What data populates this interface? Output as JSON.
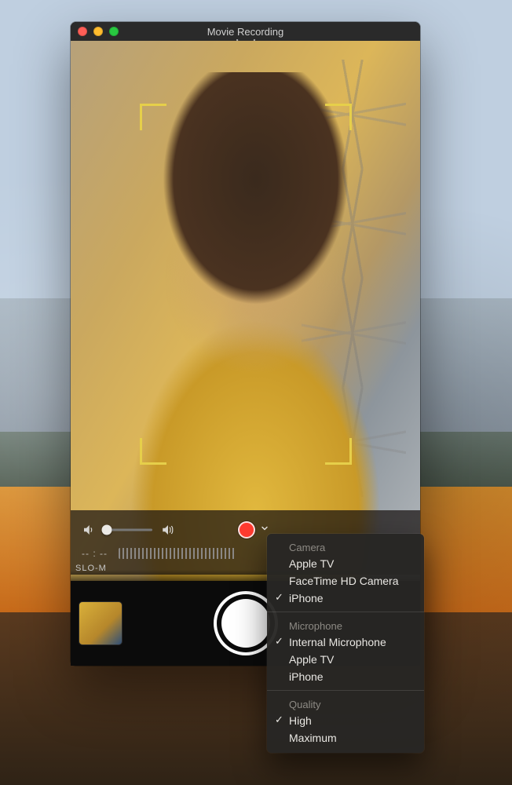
{
  "window": {
    "title": "Movie Recording"
  },
  "controls": {
    "timecode": "-- : --",
    "volume_low_icon": "speaker-low",
    "volume_high_icon": "speaker-high"
  },
  "phoneui": {
    "mode_label": "SLO-M"
  },
  "menu": {
    "camera": {
      "title": "Camera",
      "items": [
        {
          "label": "Apple TV",
          "checked": false
        },
        {
          "label": "FaceTime HD Camera",
          "checked": false
        },
        {
          "label": "iPhone",
          "checked": true
        }
      ]
    },
    "microphone": {
      "title": "Microphone",
      "items": [
        {
          "label": "Internal Microphone",
          "checked": true
        },
        {
          "label": "Apple TV",
          "checked": false
        },
        {
          "label": "iPhone",
          "checked": false
        }
      ]
    },
    "quality": {
      "title": "Quality",
      "items": [
        {
          "label": "High",
          "checked": true
        },
        {
          "label": "Maximum",
          "checked": false
        }
      ]
    }
  }
}
